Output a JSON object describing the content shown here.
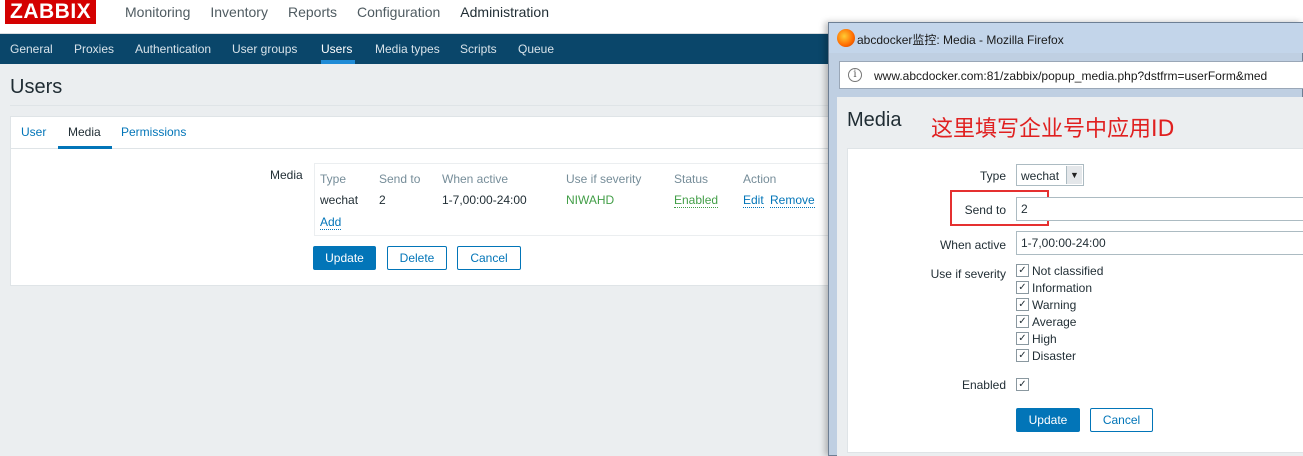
{
  "app": {
    "logo": "ZABBIX"
  },
  "main_menu": [
    {
      "label": "Monitoring"
    },
    {
      "label": "Inventory"
    },
    {
      "label": "Reports"
    },
    {
      "label": "Configuration"
    },
    {
      "label": "Administration",
      "active": true
    }
  ],
  "sub_menu": [
    {
      "label": "General"
    },
    {
      "label": "Proxies"
    },
    {
      "label": "Authentication"
    },
    {
      "label": "User groups"
    },
    {
      "label": "Users",
      "active": true
    },
    {
      "label": "Media types"
    },
    {
      "label": "Scripts"
    },
    {
      "label": "Queue"
    }
  ],
  "page": {
    "title": "Users"
  },
  "tabs": [
    {
      "label": "User"
    },
    {
      "label": "Media",
      "active": true
    },
    {
      "label": "Permissions"
    }
  ],
  "media_section": {
    "label": "Media",
    "columns": [
      "Type",
      "Send to",
      "When active",
      "Use if severity",
      "Status",
      "Action"
    ],
    "rows": [
      {
        "type": "wechat",
        "send_to": "2",
        "when_active": "1-7,00:00-24:00",
        "severity": "NIWAHD",
        "status": "Enabled",
        "action_edit": "Edit",
        "action_remove": "Remove"
      }
    ],
    "add_link": "Add"
  },
  "buttons": {
    "update": "Update",
    "delete": "Delete",
    "cancel": "Cancel"
  },
  "popup": {
    "window_title": "abcdocker监控: Media - Mozilla Firefox",
    "url": "www.abcdocker.com:81/zabbix/popup_media.php?dstfrm=userForm&med",
    "heading": "Media",
    "annotation": "这里填写企业号中应用ID",
    "form": {
      "type_label": "Type",
      "type_value": "wechat",
      "send_to_label": "Send to",
      "send_to_value": "2",
      "when_active_label": "When active",
      "when_active_value": "1-7,00:00-24:00",
      "severity_label": "Use if severity",
      "severities": [
        {
          "label": "Not classified",
          "checked": true
        },
        {
          "label": "Information",
          "checked": true
        },
        {
          "label": "Warning",
          "checked": true
        },
        {
          "label": "Average",
          "checked": true
        },
        {
          "label": "High",
          "checked": true
        },
        {
          "label": "Disaster",
          "checked": true
        }
      ],
      "enabled_label": "Enabled",
      "enabled_checked": true,
      "update_button": "Update",
      "cancel_button": "Cancel"
    }
  },
  "colors": {
    "brand_red": "#d40000",
    "nav_dark": "#0a466a",
    "link_blue": "#0275b8",
    "status_green": "#429e47",
    "annotation_red": "#e02020"
  }
}
